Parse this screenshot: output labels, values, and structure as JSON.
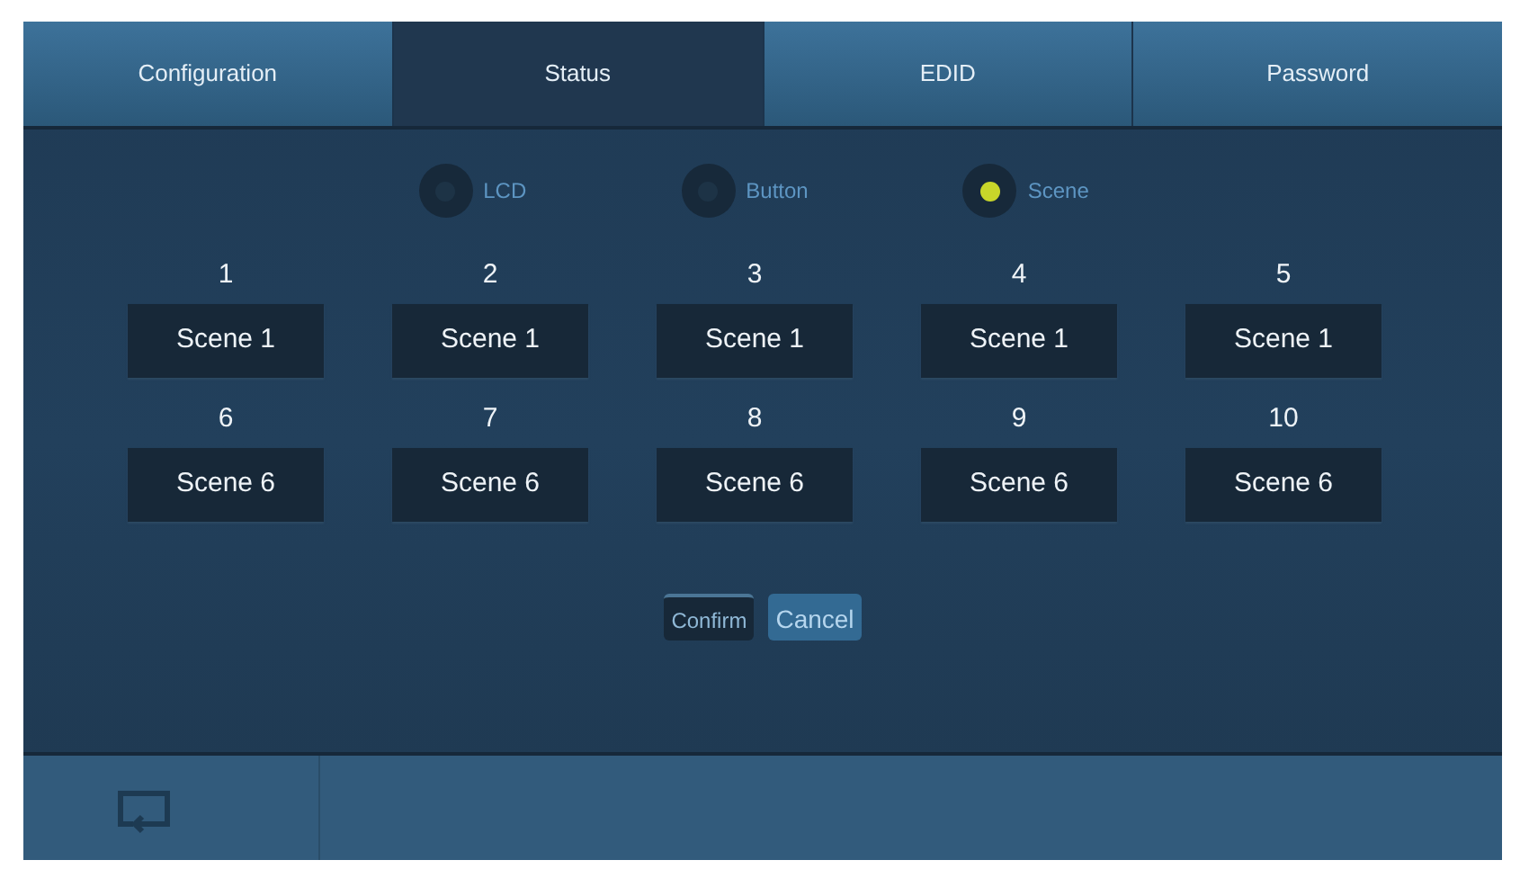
{
  "tabs": [
    {
      "label": "Configuration",
      "selected": false
    },
    {
      "label": "Status",
      "selected": true
    },
    {
      "label": "EDID",
      "selected": false
    },
    {
      "label": "Password",
      "selected": false
    }
  ],
  "modes": [
    {
      "label": "LCD",
      "selected": false
    },
    {
      "label": "Button",
      "selected": false
    },
    {
      "label": "Scene",
      "selected": true
    }
  ],
  "slots": [
    {
      "number": "1",
      "value": "Scene 1"
    },
    {
      "number": "2",
      "value": "Scene 1"
    },
    {
      "number": "3",
      "value": "Scene 1"
    },
    {
      "number": "4",
      "value": "Scene 1"
    },
    {
      "number": "5",
      "value": "Scene 1"
    },
    {
      "number": "6",
      "value": "Scene 6"
    },
    {
      "number": "7",
      "value": "Scene 6"
    },
    {
      "number": "8",
      "value": "Scene 6"
    },
    {
      "number": "9",
      "value": "Scene 6"
    },
    {
      "number": "10",
      "value": "Scene 6"
    }
  ],
  "buttons": [
    {
      "label": "Confirm",
      "kind": "dark"
    },
    {
      "label": "Cancel",
      "kind": "light"
    }
  ]
}
